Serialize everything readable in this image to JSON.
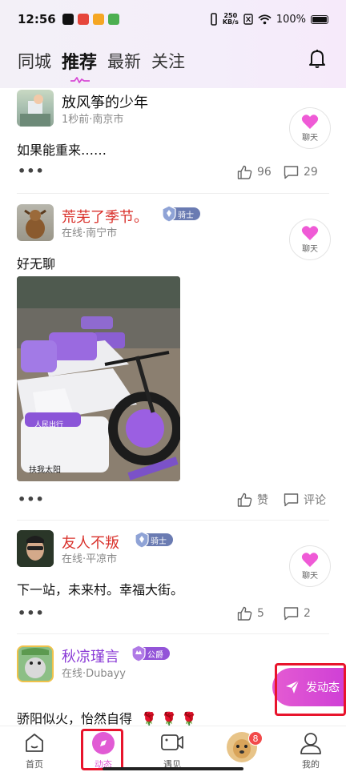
{
  "status_bar": {
    "time": "12:56",
    "net_speed_value": "250",
    "net_speed_unit": "KB/s",
    "battery_text": "100%"
  },
  "tabs": [
    {
      "label": "同城",
      "active": false
    },
    {
      "label": "推荐",
      "active": true
    },
    {
      "label": "最新",
      "active": false
    },
    {
      "label": "关注",
      "active": false
    }
  ],
  "posts": [
    {
      "username": "放风筝的少年",
      "meta": "1秒前·南京市",
      "chat_label": "聊天",
      "content": "如果能重来……",
      "like_count": "96",
      "comment_count": "29"
    },
    {
      "username": "荒芜了季节。",
      "badge": "骑士",
      "meta": "在线·南宁市",
      "chat_label": "聊天",
      "content": "好无聊",
      "like_label": "赞",
      "comment_label": "评论",
      "image_caption_text": "人民出行"
    },
    {
      "username": "友人不叛",
      "badge": "骑士",
      "meta": "在线·平凉市",
      "chat_label": "聊天",
      "content": "下一站，未来村。幸福大街。",
      "like_count": "5",
      "comment_count": "2"
    },
    {
      "username": "秋凉瑾言",
      "badge": "公爵",
      "meta": "在线·Dubayy",
      "content": "骄阳似火，怡然自得"
    }
  ],
  "fab_label": "发动态",
  "bottom_nav": [
    {
      "label": "首页",
      "icon": "home-icon"
    },
    {
      "label": "动态",
      "icon": "compass-icon",
      "active": true
    },
    {
      "label": "遇见",
      "icon": "video-icon"
    },
    {
      "label": "",
      "icon": "avatar-dog",
      "badge_count": "8"
    },
    {
      "label": "我的",
      "icon": "user-icon"
    }
  ],
  "colors": {
    "accent": "#e45bd2",
    "username_red": "#d9312b",
    "username_purple": "#8a3ad6",
    "highlight_red": "#e8142c"
  }
}
